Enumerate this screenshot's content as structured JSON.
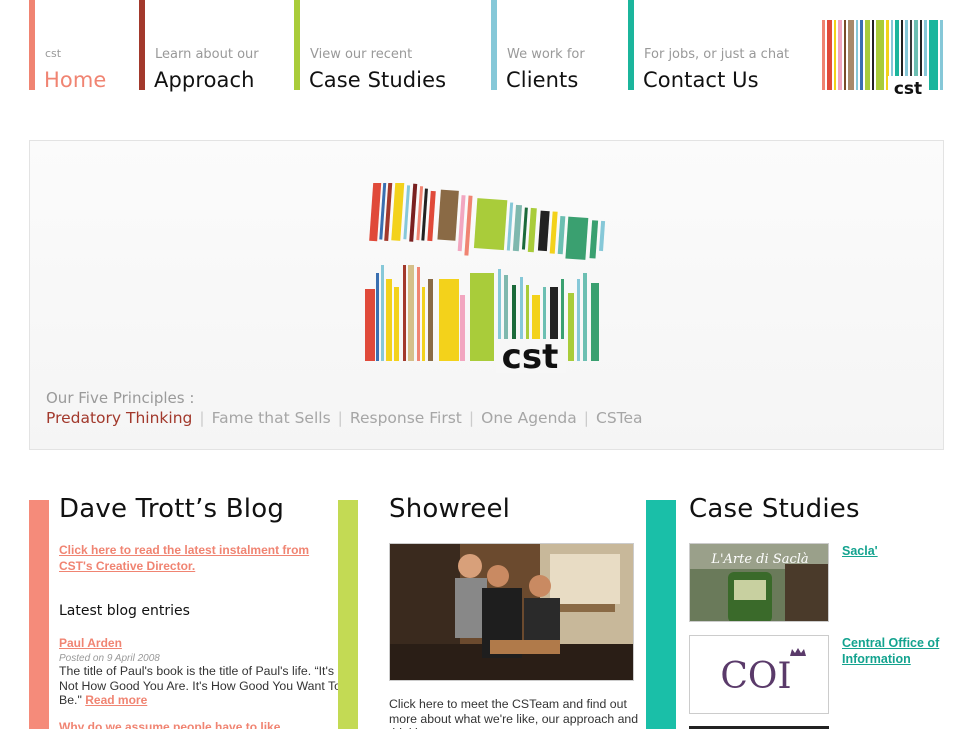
{
  "nav": {
    "items": [
      {
        "sub": "cst",
        "title": "Home",
        "color": "#f08472"
      },
      {
        "sub": "Learn about our",
        "title": "Approach",
        "color": "#a2392c"
      },
      {
        "sub": "View our recent",
        "title": "Case Studies",
        "color": "#a9cc3a"
      },
      {
        "sub": "We work for",
        "title": "Clients",
        "color": "#86c8d8"
      },
      {
        "sub": "For jobs, or just a chat",
        "title": "Contact Us",
        "color": "#1bb59c"
      }
    ]
  },
  "brand": {
    "logo_text": "cst"
  },
  "hero": {
    "principles_label": "Our Five Principles :",
    "principles": [
      "Predatory Thinking",
      "Fame that Sells",
      "Response First",
      "One Agenda",
      "CSTea"
    ]
  },
  "blog": {
    "title": "Dave Trott’s Blog",
    "intro_link": "Click here to read the latest instalment from CST's Creative Director.",
    "latest_heading": "Latest blog entries",
    "entries": [
      {
        "title": "Paul Arden",
        "date": "Posted on 9 April 2008",
        "text": "The title of Paul's book is the title of Paul's life. “It's Not How Good You Are. It's How Good You Want To Be.\"",
        "read_more": "Read more"
      },
      {
        "title": "Why do we assume people have to like"
      }
    ]
  },
  "showreel": {
    "title": "Showreel",
    "text": "Click here to meet the CSTeam and find out more about what we're like, our approach and thinking."
  },
  "case_studies": {
    "title": "Case Studies",
    "items": [
      {
        "name": "Sacla'",
        "thumb_text": "L'Arte di Saclà"
      },
      {
        "name": "Central Office of Information",
        "thumb_text": "COI"
      }
    ]
  },
  "colors": {
    "salmon": "#f08472",
    "maroon": "#a2392c",
    "lime": "#a9cc3a",
    "sky": "#86c8d8",
    "teal": "#1bb59c"
  }
}
